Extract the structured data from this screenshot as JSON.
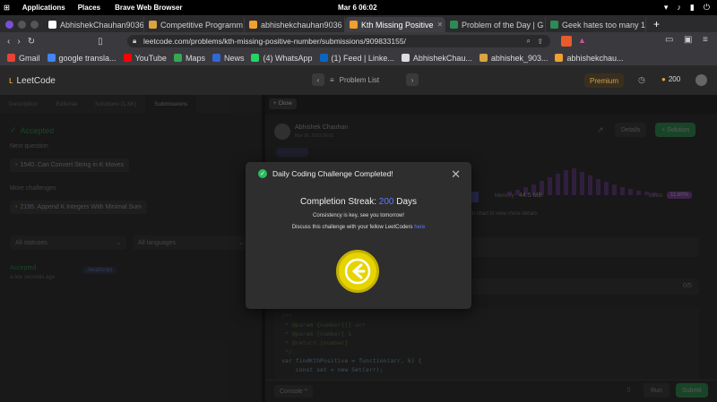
{
  "os": {
    "applications": "Applications",
    "places": "Places",
    "browser": "Brave Web Browser",
    "clock": "Mar 6  06:02"
  },
  "tabs": [
    {
      "label": "AbhishekChauhan9036",
      "color": "#ffffff"
    },
    {
      "label": "Competitive Programm",
      "color": "#d9a441"
    },
    {
      "label": "abhishekchauhan9036",
      "color": "#f0a030"
    },
    {
      "label": "Kth Missing Positive",
      "color": "#f0a030",
      "active": true
    },
    {
      "label": "Problem of the Day | G",
      "color": "#2e8b57"
    },
    {
      "label": "Geek hates too many 1",
      "color": "#2e8b57"
    }
  ],
  "address": {
    "url": "leetcode.com/problems/kth-missing-positive-number/submissions/909833155/"
  },
  "bookmarks": [
    "Gmail",
    "google transla...",
    "YouTube",
    "Maps",
    "News",
    "(4) WhatsApp",
    "(1) Feed | Linke...",
    "AbhishekChau...",
    "abhishek_903...",
    "abhishekchau..."
  ],
  "lc": {
    "logo": "LeetCode",
    "problem_list": "Problem List",
    "premium": "Premium",
    "streak": "200"
  },
  "left": {
    "tabs": [
      "Description",
      "Editorial",
      "Solutions (1.8K)",
      "Submissions"
    ],
    "accepted": "Accepted",
    "next_question": "Next question",
    "next_item": "1540. Can Convert String in K Moves",
    "more": "More challenges",
    "more_item": "2195. Append K Integers With Minimal Sum",
    "filter1": "All statuses",
    "filter2": "All languages",
    "row_status": "Accepted",
    "row_time": "a few seconds ago",
    "row_lang": "JavaScript"
  },
  "right": {
    "close": "Close",
    "user": "Abhishek Chauhan",
    "date": "Mar 06, 2023 06:01",
    "details": "Details",
    "solution": "+ Solution",
    "memory_label": "Memory",
    "memory_val": "44.5 MB",
    "beats": "Beats",
    "beats_val": "11.60%",
    "chart_hint": "ion chart to view more details",
    "testcases": "0/5",
    "code": [
      "/**",
      " * @param {number[]} arr",
      " * @param {number} k",
      " * @return {number}",
      " */",
      "var findKthPositive = function(arr, k) {",
      "    const set = new Set(arr);"
    ],
    "console": "Console ^",
    "run": "Run",
    "submit": "Submit"
  },
  "modal": {
    "title": "Daily Coding Challenge Completed!",
    "streak_label": "Completion Streak:",
    "streak_num": "200",
    "streak_unit": "Days",
    "sub1": "Consistency is key, see you tomorrow!",
    "sub2": "Discuss this challenge with your fellow LeetCoders",
    "here": "here"
  }
}
